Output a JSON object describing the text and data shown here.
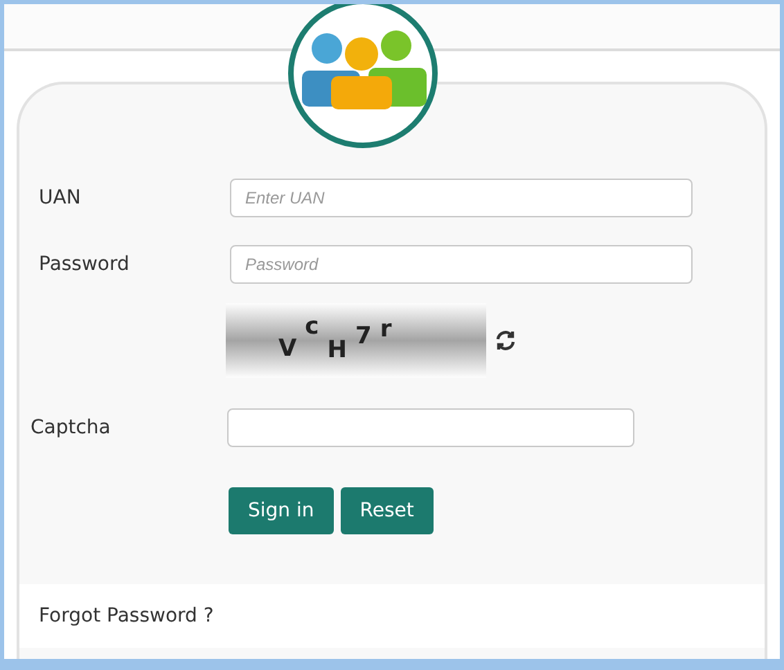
{
  "fields": [
    {
      "label": "UAN",
      "placeholder": "Enter UAN"
    },
    {
      "label": "Password",
      "placeholder": "Password"
    }
  ],
  "captcha": {
    "chars": [
      "V",
      "c",
      "H",
      "7",
      "r"
    ],
    "label": "Captcha"
  },
  "buttons": [
    "Sign in",
    "Reset"
  ],
  "forgot_link": "Forgot Password ?"
}
